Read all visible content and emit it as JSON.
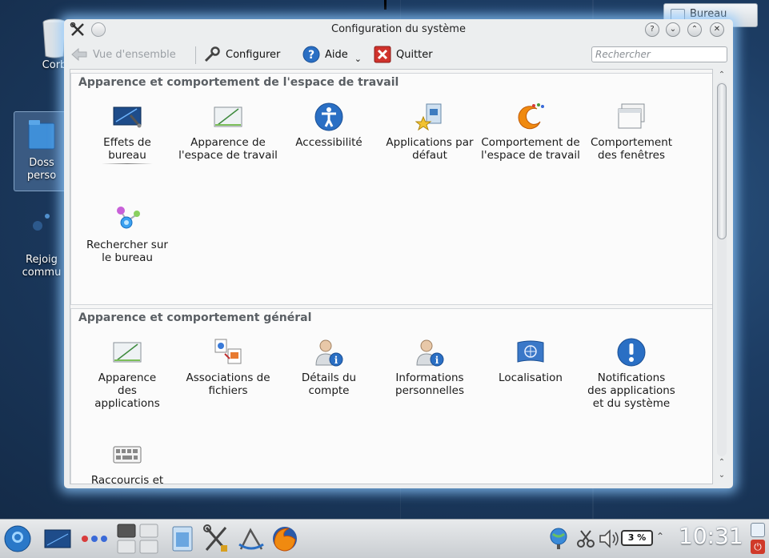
{
  "desktop": {
    "icons": [
      {
        "label": "Corb"
      },
      {
        "label": "Doss\nperso"
      },
      {
        "label": "Rejoig\ncommu"
      }
    ],
    "bureau_tab": "Bureau"
  },
  "window": {
    "title": "Configuration du système",
    "toolbar": {
      "overview": "Vue d'ensemble",
      "configure": "Configurer",
      "help": "Aide",
      "quit": "Quitter",
      "search_placeholder": "Rechercher"
    },
    "sections": [
      {
        "title": "Apparence et comportement de l'espace de travail",
        "items": [
          {
            "label": "Effets de bureau",
            "icon": "desktop-effects-icon"
          },
          {
            "label": "Apparence de l'espace de travail",
            "icon": "workspace-appearance-icon"
          },
          {
            "label": "Accessibilité",
            "icon": "accessibility-icon"
          },
          {
            "label": "Applications par défaut",
            "icon": "default-apps-icon"
          },
          {
            "label": "Comportement de l'espace de travail",
            "icon": "workspace-behavior-icon"
          },
          {
            "label": "Comportement des fenêtres",
            "icon": "window-behavior-icon"
          },
          {
            "label": "Rechercher sur le bureau",
            "icon": "desktop-search-icon"
          }
        ]
      },
      {
        "title": "Apparence et comportement général",
        "items": [
          {
            "label": "Apparence des applications",
            "icon": "app-appearance-icon"
          },
          {
            "label": "Associations de fichiers",
            "icon": "file-associations-icon"
          },
          {
            "label": "Détails du compte",
            "icon": "account-details-icon"
          },
          {
            "label": "Informations personnelles",
            "icon": "personal-info-icon"
          },
          {
            "label": "Localisation",
            "icon": "locale-flag-icon"
          },
          {
            "label": "Notifications des applications et du système",
            "icon": "notifications-icon"
          },
          {
            "label": "Raccourcis et",
            "icon": "shortcuts-keyboard-icon"
          }
        ]
      }
    ]
  },
  "taskbar": {
    "battery": "3 %",
    "clock": "10:31"
  },
  "colors": {
    "window_glow": "#8cc8ff",
    "accent_blue": "#2a6fc4",
    "quit_red": "#d0322c"
  }
}
